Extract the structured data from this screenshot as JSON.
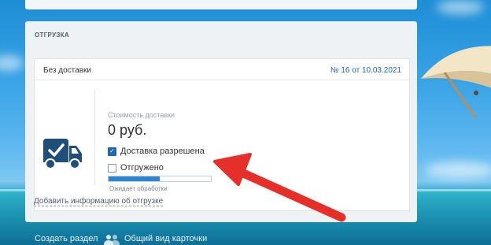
{
  "card": {
    "header": "ОТГРУЗКА",
    "delivery_title": "Без доставки",
    "document_number": "№ 16 от 10.03.2021",
    "cost_label": "Стоимость доставки",
    "cost_value": "0 руб.",
    "checkbox_delivery_allowed": {
      "label": "Доставка разрешена",
      "checked": true
    },
    "checkbox_shipped": {
      "label": "Отгружено",
      "checked": false
    },
    "progress": {
      "fraction": 0.5,
      "status": "Ожидает обработки"
    },
    "add_info_link": "Добавить информацию об отгрузке"
  },
  "footer": {
    "create_section": "Создать раздел",
    "common_view": "Общий вид карточки"
  },
  "colors": {
    "accent": "#2067b0",
    "progress": "#2e86d1",
    "arrow": "#e5302a"
  },
  "icons": [
    "truck-icon",
    "check-icon",
    "people-icon",
    "arrow-annotation"
  ]
}
